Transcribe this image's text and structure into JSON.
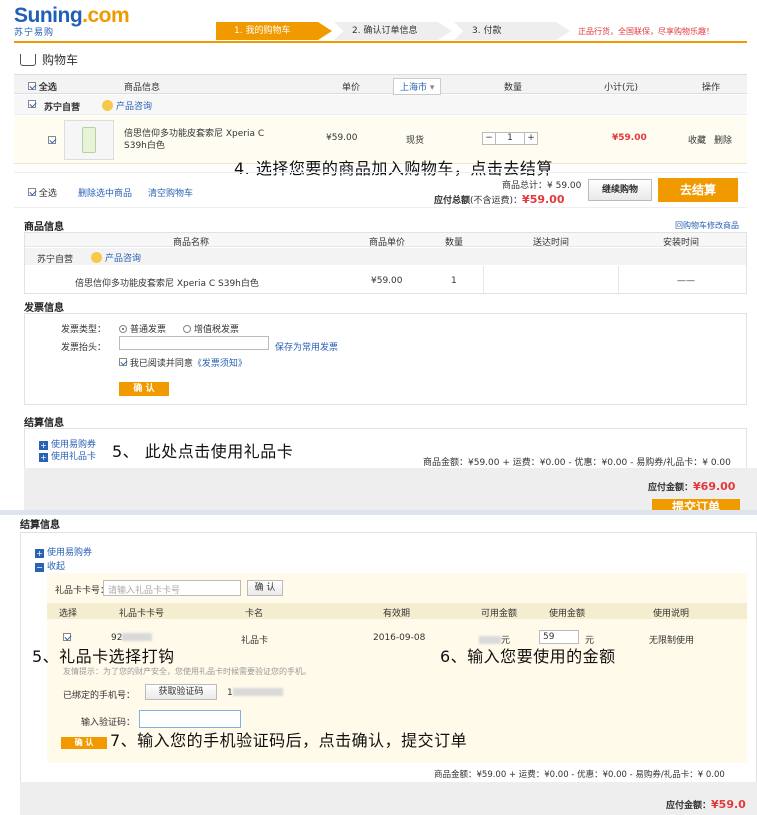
{
  "header": {
    "logo_en_main": "Suning",
    "logo_en_dot": ".com",
    "logo_cn": "苏宁易购",
    "steps": [
      "1. 我的购物车",
      "2. 确认订单信息",
      "3. 付款"
    ],
    "slogan": "正品行货，全国联保，尽享购物乐趣！"
  },
  "cart": {
    "title": "购物车",
    "columns": {
      "select_all": "全选",
      "product": "商品信息",
      "price": "单价",
      "location": "上海市",
      "qty": "数量",
      "subtotal": "小计(元)",
      "action": "操作"
    },
    "shop_name": "苏宁自营",
    "consult": "产品咨询",
    "item": {
      "name": "倍思信仰多功能皮套索尼 Xperia C S39h白色",
      "price": "¥59.00",
      "stock": "现货",
      "qty": "1",
      "minus": "−",
      "plus": "+",
      "subtotal": "¥59.00",
      "favorite": "收藏",
      "delete": "删除"
    },
    "footer": {
      "select_all": "全选",
      "delete_selected": "删除选中商品",
      "clear_cart": "清空购物车",
      "total_line": "商品总计：¥ 59.00",
      "payable_label": "应付总额",
      "payable_note": "(不含运费)：",
      "payable_value": "¥59.00",
      "continue_btn": "继续购物",
      "checkout_btn": "去结算"
    }
  },
  "instructions": {
    "step4": "4. 选择您要的商品加入购物车，点击去结算",
    "step5a": "5、 此处点击使用礼品卡",
    "step5b": "5、礼品卡选择打钩",
    "step6": "6、输入您要使用的金额",
    "step7": "7、输入您的手机验证码后，点击确认，提交订单"
  },
  "order": {
    "title": "商品信息",
    "back_link": "回购物车修改商品",
    "columns": [
      "商品名称",
      "商品单价",
      "数量",
      "送达时间",
      "安装时间"
    ],
    "shop_name": "苏宁自营",
    "consult": "产品咨询",
    "row": {
      "name": "倍思信仰多功能皮套索尼 Xperia C S39h白色",
      "price": "¥59.00",
      "qty": "1",
      "install": "——"
    }
  },
  "invoice": {
    "title": "发票信息",
    "type_label": "发票类型：",
    "type_normal": "普通发票",
    "type_vat": "增值税发票",
    "header_label": "发票抬头：",
    "save_common": "保存为常用发票",
    "agree_text": "我已阅读并同意",
    "agree_link": "《发票须知》",
    "confirm_btn": "确 认"
  },
  "settle": {
    "title": "结算信息",
    "use_coupon": "使用易购券",
    "use_giftcard": "使用礼品卡",
    "summary": "商品金额：¥59.00 + 运费：¥0.00 - 优惠：¥0.00 - 易购券/礼品卡：¥ 0.00",
    "payable_label": "应付金额：",
    "payable_value": "¥69.00",
    "submit_btn": "提交订单"
  },
  "settle2": {
    "title": "结算信息",
    "use_coupon": "使用易购券",
    "collapse": "收起",
    "card_no_label": "礼品卡卡号：",
    "card_no_placeholder": "请输入礼品卡卡号",
    "confirm_btn": "确 认",
    "columns": [
      "选择",
      "礼品卡卡号",
      "卡名",
      "有效期",
      "可用金额",
      "使用金额",
      "使用说明"
    ],
    "row": {
      "card_prefix": "92",
      "card_name": "礼品卡",
      "expiry": "2016-09-08",
      "available_suffix": "元",
      "use_amount": "59",
      "use_unit": "元",
      "note": "无限制使用"
    },
    "tip": "友情提示：为了您的财产安全，您使用礼品卡时候需要验证您的手机。",
    "phone_label": "已绑定的手机号：",
    "get_code_btn": "获取验证码",
    "phone_prefix": "1",
    "code_label": "输入验证码：",
    "summary": "商品金额：¥59.00 + 运费：¥0.00 - 优惠：¥0.00 - 易购券/礼品卡：¥ 0.00",
    "payable_label": "应付金额：",
    "payable_value": "¥59.0"
  }
}
